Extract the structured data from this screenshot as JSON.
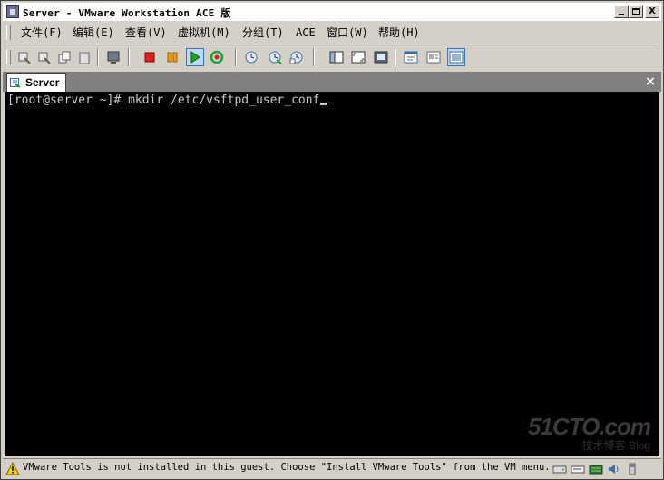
{
  "window": {
    "title": "Server - VMware Workstation ACE 版",
    "controls": {
      "minimize": "_",
      "maximize": "□",
      "close": "X"
    }
  },
  "menu": [
    {
      "label": "文件(F)",
      "name": "menu-file"
    },
    {
      "label": "编辑(E)",
      "name": "menu-edit"
    },
    {
      "label": "查看(V)",
      "name": "menu-view"
    },
    {
      "label": "虚拟机(M)",
      "name": "menu-vm"
    },
    {
      "label": "分组(T)",
      "name": "menu-team"
    },
    {
      "label": "ACE",
      "name": "menu-ace"
    },
    {
      "label": "窗口(W)",
      "name": "menu-window"
    },
    {
      "label": "帮助(H)",
      "name": "menu-help"
    }
  ],
  "toolbar": {
    "icons": [
      "shortcut-icon",
      "shortcut-icon",
      "clone-icon",
      "trash-icon",
      "screen-icon",
      "stop-icon",
      "pause-icon",
      "play-icon",
      "reset-icon",
      "snapshot-icon",
      "revert-snapshot-icon",
      "snapshot-manager-icon",
      "sidebar-icon",
      "fit-window-icon",
      "fullscreen-icon",
      "summary-view-icon",
      "appliance-view-icon",
      "console-view-icon"
    ],
    "colors": {
      "stop": "#e02020",
      "pause": "#f0a000",
      "play": "#20a020",
      "reset": "#20a040"
    }
  },
  "tab": {
    "label": "Server",
    "close_glyph": "×"
  },
  "console": {
    "prompt": "[root@server ~]# ",
    "command": "mkdir /etc/vsftpd_user_conf",
    "background": "#000000",
    "foreground": "#c8c8c8"
  },
  "watermark": {
    "main": "51CTO.com",
    "sub": "技术博客  Blog"
  },
  "status": {
    "message": "VMware Tools is not installed in this guest. Choose \"Install VMware Tools\" from the VM menu.",
    "devices": [
      "hard-disk-icon",
      "cdrom-icon",
      "network-icon",
      "sound-icon",
      "usb-icon"
    ]
  }
}
